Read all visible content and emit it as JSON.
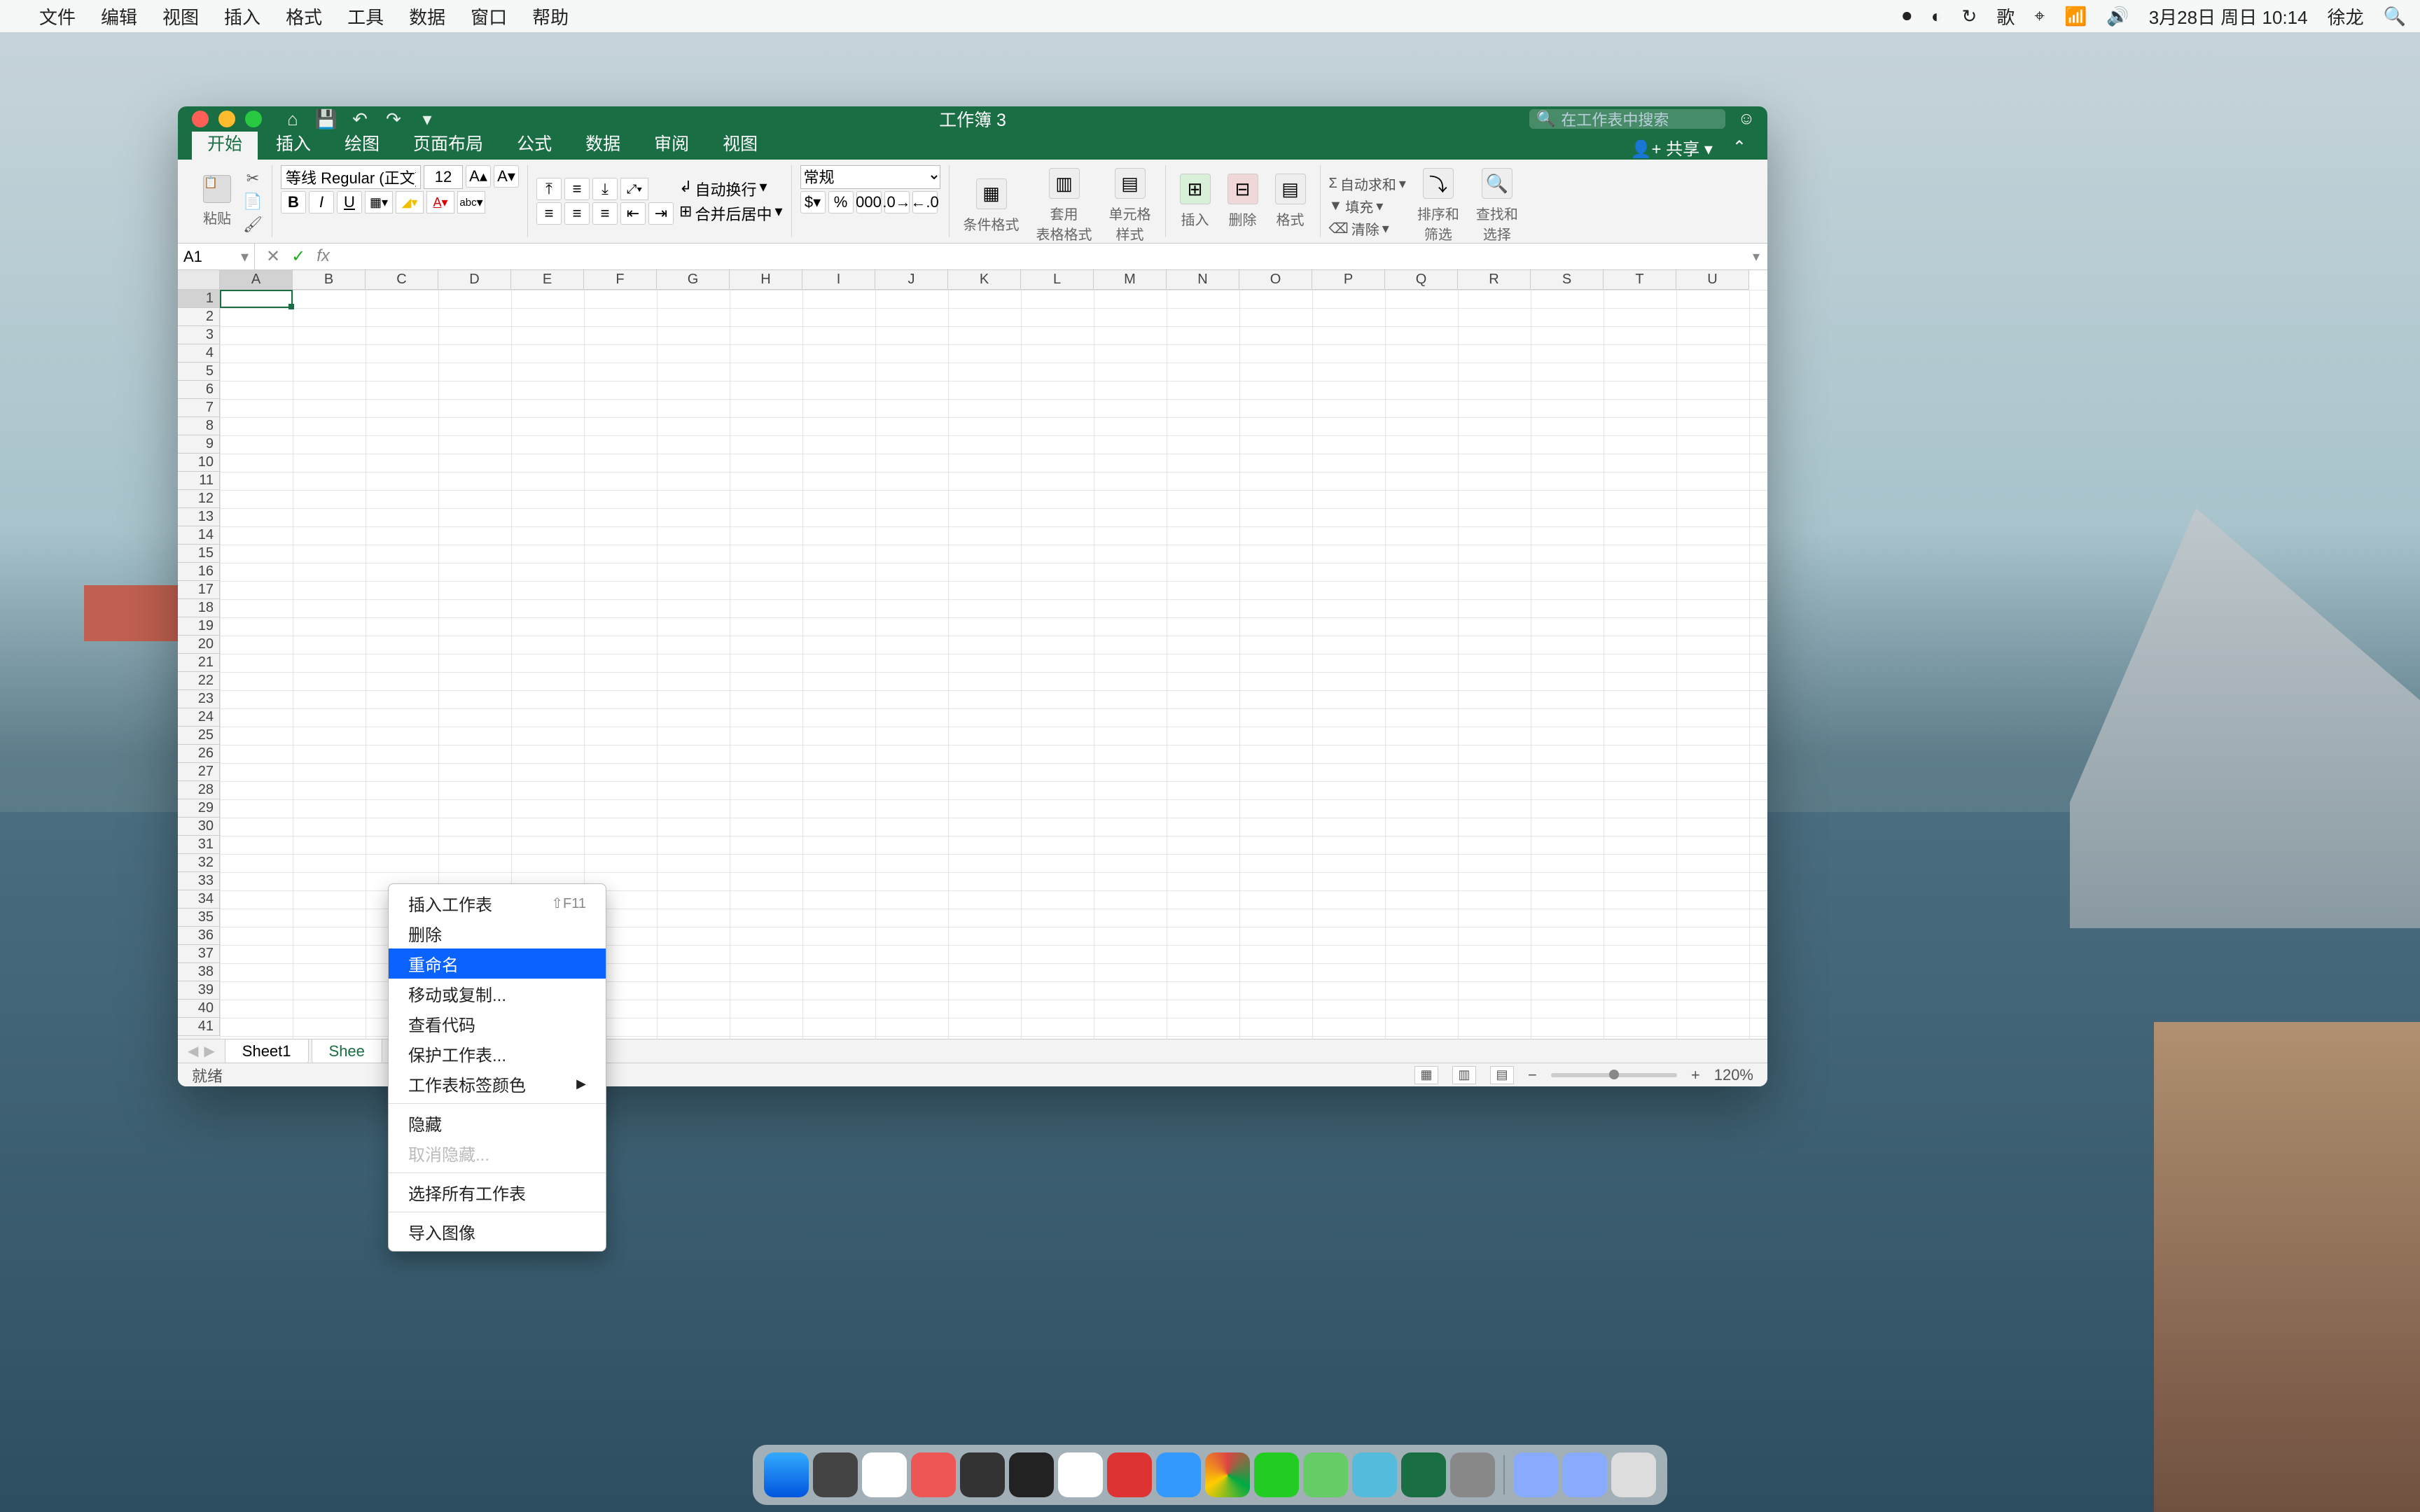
{
  "macos_menu": {
    "items": [
      "文件",
      "编辑",
      "视图",
      "插入",
      "格式",
      "工具",
      "数据",
      "窗口",
      "帮助"
    ],
    "right_items": [
      "歌",
      "3月28日 周日  10:14",
      "徐龙"
    ]
  },
  "titlebar": {
    "title": "工作簿 3",
    "search_placeholder": "在工作表中搜索"
  },
  "ribbon_tabs": [
    "开始",
    "插入",
    "绘图",
    "页面布局",
    "公式",
    "数据",
    "审阅",
    "视图"
  ],
  "share_label": "共享",
  "ribbon": {
    "paste_label": "粘贴",
    "font_name": "等线 Regular (正文)",
    "font_size": "12",
    "wrap_text": "自动换行",
    "merge_center": "合并后居中",
    "number_format": "常规",
    "cond_fmt": "条件格式",
    "table_fmt": "套用\n表格格式",
    "cell_style": "单元格\n样式",
    "insert_lbl": "插入",
    "delete_lbl": "删除",
    "format_lbl": "格式",
    "autosum": "自动求和",
    "fill": "填充",
    "clear": "清除",
    "sort_filter": "排序和\n筛选",
    "find_select": "查找和\n选择"
  },
  "name_box": "A1",
  "fx_label": "fx",
  "columns": [
    "A",
    "B",
    "C",
    "D",
    "E",
    "F",
    "G",
    "H",
    "I",
    "J",
    "K",
    "L",
    "M",
    "N",
    "O",
    "P",
    "Q",
    "R",
    "S",
    "T",
    "U"
  ],
  "row_count": 41,
  "sheets": {
    "sheet1": "Sheet1",
    "sheet2_prefix": "Shee"
  },
  "status": {
    "ready": "就绪",
    "zoom": "120%"
  },
  "context_menu": {
    "insert_sheet": "插入工作表",
    "insert_shortcut": "⇧F11",
    "delete": "删除",
    "rename": "重命名",
    "move_copy": "移动或复制...",
    "view_code": "查看代码",
    "protect": "保护工作表...",
    "tab_color": "工作表标签颜色",
    "hide": "隐藏",
    "unhide": "取消隐藏...",
    "select_all": "选择所有工作表",
    "import_image": "导入图像"
  }
}
